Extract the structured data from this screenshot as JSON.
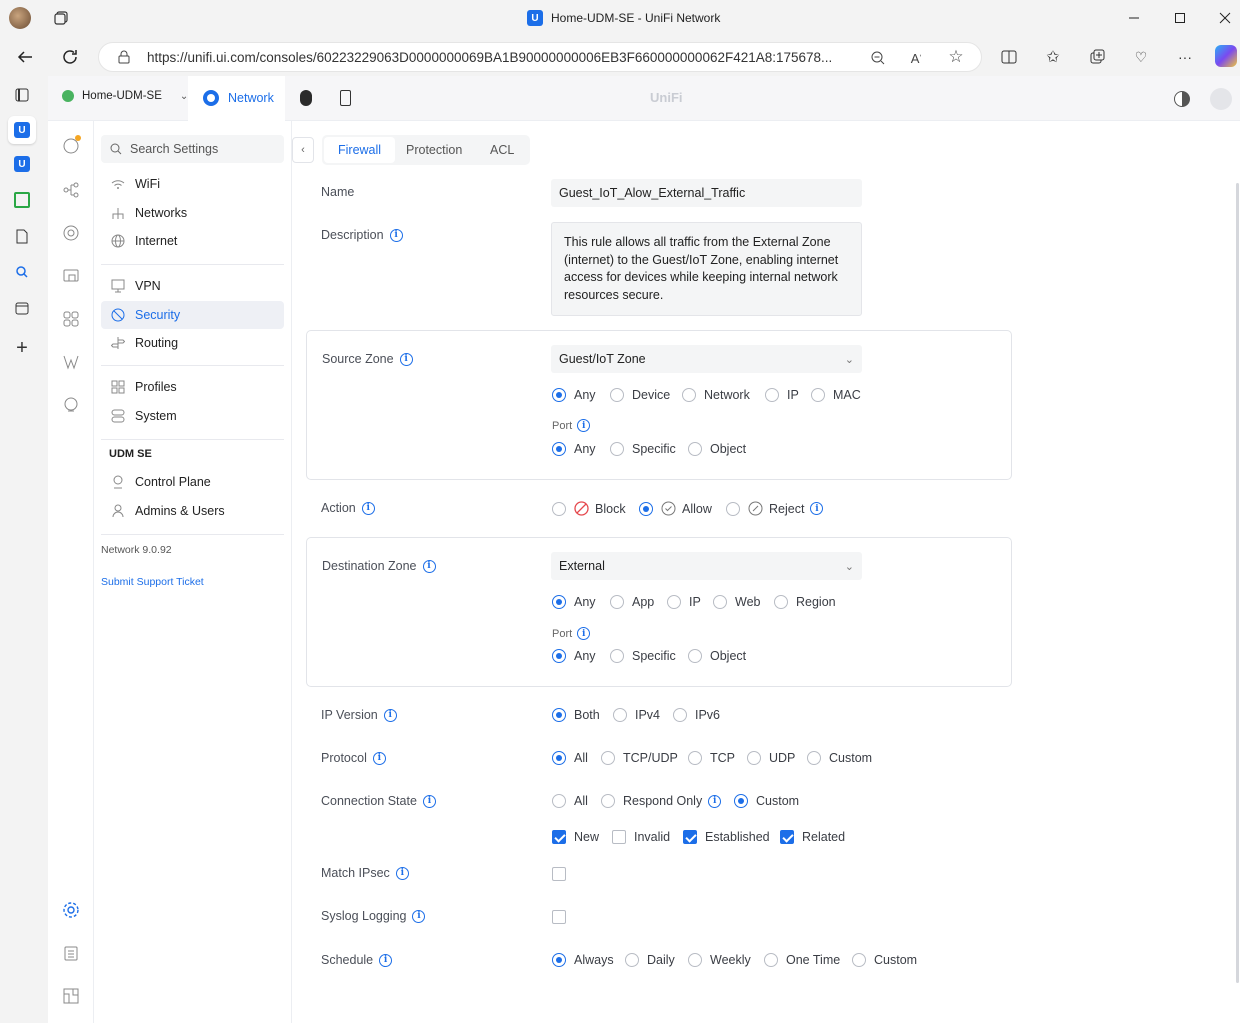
{
  "browser": {
    "title": "Home-UDM-SE - UniFi Network",
    "url": "https://unifi.ui.com/consoles/60223229063D0000000069BA1B90000000006EB3F660000000062F421A8:175678..."
  },
  "app": {
    "console_name": "Home-UDM-SE",
    "app_tab": "Network",
    "brand": "UniFi"
  },
  "nav": {
    "search_placeholder": "Search Settings",
    "group1": [
      "WiFi",
      "Networks",
      "Internet"
    ],
    "group2": [
      "VPN",
      "Security",
      "Routing"
    ],
    "group3": [
      "Profiles",
      "System"
    ],
    "device_heading": "UDM SE",
    "group4": [
      "Control Plane",
      "Admins & Users"
    ],
    "version": "Network 9.0.92",
    "support_link": "Submit Support Ticket"
  },
  "tabs": [
    "Firewall",
    "Protection",
    "ACL"
  ],
  "form": {
    "name_label": "Name",
    "name_value": "Guest_IoT_Alow_External_Traffic",
    "description_label": "Description",
    "description_value": "This rule allows all traffic from the External Zone (internet) to the Guest/IoT Zone, enabling internet access for devices while keeping internal network resources secure.",
    "source_zone_label": "Source Zone",
    "source_zone_value": "Guest/IoT Zone",
    "source_options": [
      "Any",
      "Device",
      "Network",
      "IP",
      "MAC"
    ],
    "port_label": "Port",
    "port_options": [
      "Any",
      "Specific",
      "Object"
    ],
    "action_label": "Action",
    "action_options": [
      "Block",
      "Allow",
      "Reject"
    ],
    "dest_zone_label": "Destination Zone",
    "dest_zone_value": "External",
    "dest_options": [
      "Any",
      "App",
      "IP",
      "Web",
      "Region"
    ],
    "ip_version_label": "IP Version",
    "ip_version_options": [
      "Both",
      "IPv4",
      "IPv6"
    ],
    "protocol_label": "Protocol",
    "protocol_options": [
      "All",
      "TCP/UDP",
      "TCP",
      "UDP",
      "Custom"
    ],
    "conn_state_label": "Connection State",
    "conn_state_options": [
      "All",
      "Respond Only",
      "Custom"
    ],
    "conn_state_checks": [
      "New",
      "Invalid",
      "Established",
      "Related"
    ],
    "match_ipsec_label": "Match IPsec",
    "syslog_label": "Syslog Logging",
    "schedule_label": "Schedule",
    "schedule_options": [
      "Always",
      "Daily",
      "Weekly",
      "One Time",
      "Custom"
    ]
  },
  "colors": {
    "accent": "#1c6ee8"
  }
}
